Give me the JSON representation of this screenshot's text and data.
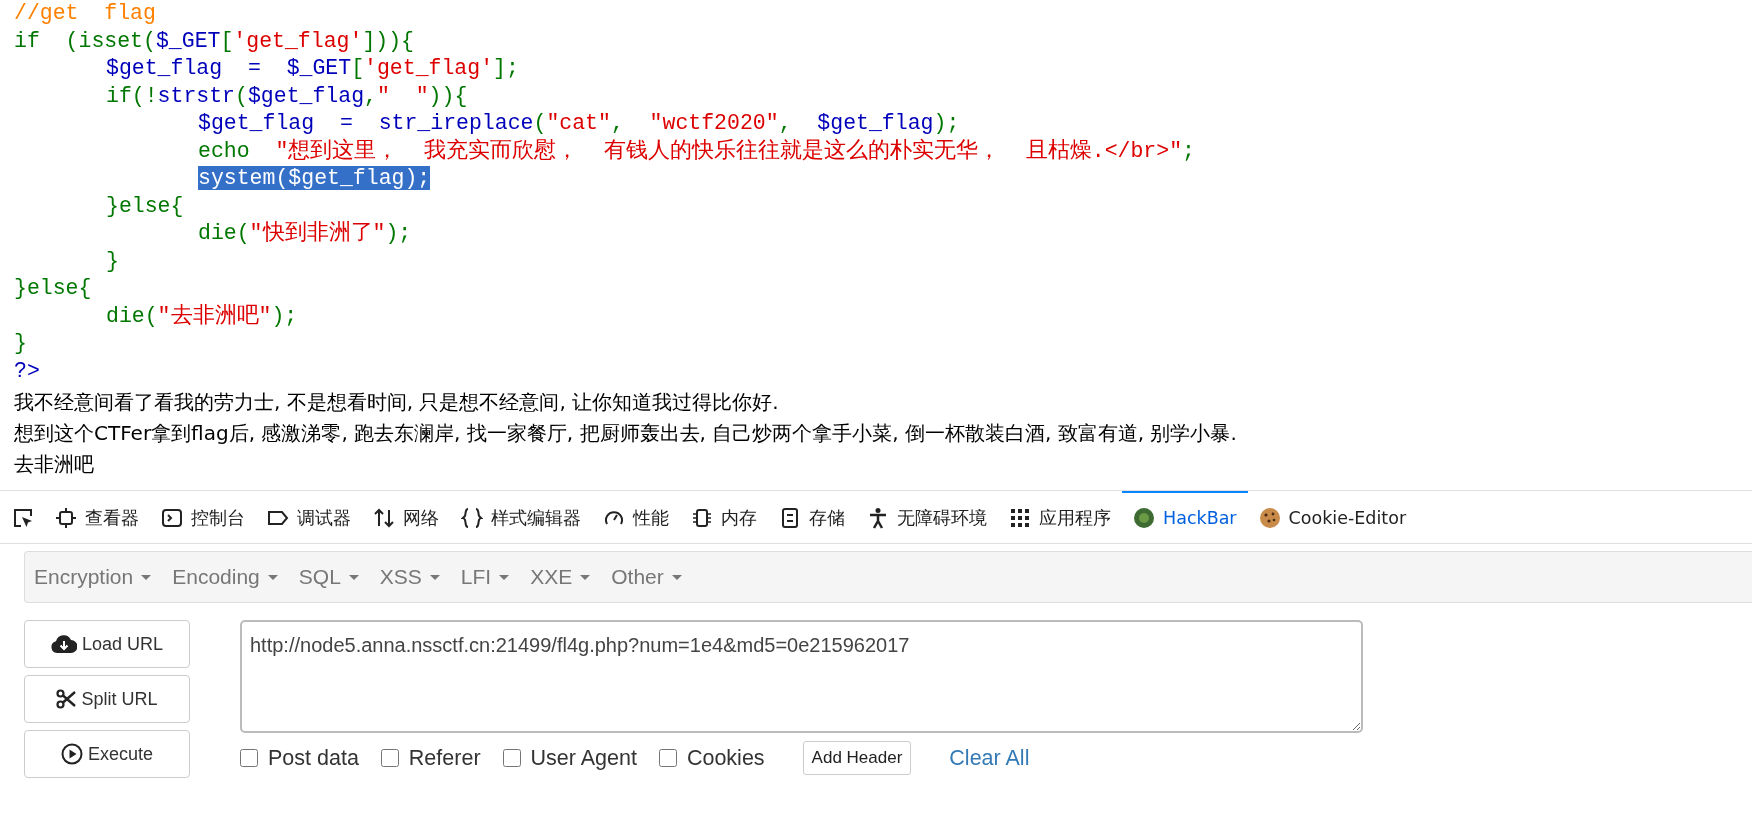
{
  "code": {
    "lines": [
      {
        "selected": false,
        "tokens": [
          {
            "t": "//get  flag",
            "kind": "comment"
          }
        ]
      },
      {
        "selected": false,
        "tokens": [
          {
            "t": "if  (isset(",
            "kind": "keyword"
          },
          {
            "t": "$_GET",
            "kind": "default"
          },
          {
            "t": "[",
            "kind": "keyword"
          },
          {
            "t": "'get_flag'",
            "kind": "string"
          },
          {
            "t": "])){",
            "kind": "keyword"
          }
        ],
        "children": [
          {
            "selected": false,
            "tokens": [
              {
                "t": "$get_flag  =  $_GET",
                "kind": "default"
              },
              {
                "t": "[",
                "kind": "keyword"
              },
              {
                "t": "'get_flag'",
                "kind": "string"
              },
              {
                "t": "];",
                "kind": "keyword"
              }
            ]
          },
          {
            "selected": false,
            "tokens": [
              {
                "t": "if(!",
                "kind": "keyword"
              },
              {
                "t": "strstr",
                "kind": "default"
              },
              {
                "t": "(",
                "kind": "keyword"
              },
              {
                "t": "$get_flag",
                "kind": "default"
              },
              {
                "t": ",",
                "kind": "keyword"
              },
              {
                "t": "\"  \"",
                "kind": "string"
              },
              {
                "t": ")){",
                "kind": "keyword"
              }
            ],
            "children": [
              {
                "selected": false,
                "tokens": [
                  {
                    "t": "$get_flag  =  str_ireplace",
                    "kind": "default"
                  },
                  {
                    "t": "(",
                    "kind": "keyword"
                  },
                  {
                    "t": "\"cat\"",
                    "kind": "string"
                  },
                  {
                    "t": ",  ",
                    "kind": "keyword"
                  },
                  {
                    "t": "\"wctf2020\"",
                    "kind": "string"
                  },
                  {
                    "t": ",  ",
                    "kind": "keyword"
                  },
                  {
                    "t": "$get_flag",
                    "kind": "default"
                  },
                  {
                    "t": ");",
                    "kind": "keyword"
                  }
                ]
              },
              {
                "selected": false,
                "tokens": [
                  {
                    "t": "echo  ",
                    "kind": "keyword"
                  },
                  {
                    "t": "\"想到这里，  我充实而欣慰，  有钱人的快乐往往就是这么的朴实无华，  且枯燥.</br>\"",
                    "kind": "string"
                  },
                  {
                    "t": ";",
                    "kind": "keyword"
                  }
                ]
              },
              {
                "selected": true,
                "tokens": [
                  {
                    "t": "system",
                    "kind": "default"
                  },
                  {
                    "t": "(",
                    "kind": "keyword"
                  },
                  {
                    "t": "$get_flag",
                    "kind": "default"
                  },
                  {
                    "t": ");",
                    "kind": "keyword"
                  }
                ]
              }
            ]
          },
          {
            "selected": false,
            "tokens": [
              {
                "t": "}else{",
                "kind": "keyword"
              }
            ],
            "children": [
              {
                "selected": false,
                "tokens": [
                  {
                    "t": "die(",
                    "kind": "keyword"
                  },
                  {
                    "t": "\"快到非洲了\"",
                    "kind": "string"
                  },
                  {
                    "t": ");",
                    "kind": "keyword"
                  }
                ]
              }
            ]
          },
          {
            "selected": false,
            "tokens": [
              {
                "t": "}",
                "kind": "keyword"
              }
            ]
          }
        ]
      },
      {
        "selected": false,
        "tokens": [
          {
            "t": "}else{",
            "kind": "keyword"
          }
        ],
        "children": [
          {
            "selected": false,
            "tokens": [
              {
                "t": "die(",
                "kind": "keyword"
              },
              {
                "t": "\"去非洲吧\"",
                "kind": "string"
              },
              {
                "t": ");",
                "kind": "keyword"
              }
            ]
          }
        ]
      },
      {
        "selected": false,
        "tokens": [
          {
            "t": "}",
            "kind": "keyword"
          }
        ]
      },
      {
        "selected": false,
        "tokens": [
          {
            "t": "?>",
            "kind": "default"
          }
        ]
      }
    ]
  },
  "output": [
    "我不经意间看了看我的劳力士, 不是想看时间, 只是想不经意间, 让你知道我过得比你好.",
    "想到这个CTFer拿到flag后, 感激涕零, 跑去东澜岸, 找一家餐厅, 把厨师轰出去, 自己炒两个拿手小菜, 倒一杯散装白酒, 致富有道, 别学小暴.",
    "去非洲吧"
  ],
  "devtools": {
    "tabs": [
      {
        "label": "查看器",
        "selected": false
      },
      {
        "label": "控制台",
        "selected": false
      },
      {
        "label": "调试器",
        "selected": false
      },
      {
        "label": "网络",
        "selected": false
      },
      {
        "label": "样式编辑器",
        "selected": false
      },
      {
        "label": "性能",
        "selected": false
      },
      {
        "label": "内存",
        "selected": false
      },
      {
        "label": "存储",
        "selected": false
      },
      {
        "label": "无障碍环境",
        "selected": false
      },
      {
        "label": "应用程序",
        "selected": false
      },
      {
        "label": "HackBar",
        "selected": true
      },
      {
        "label": "Cookie-Editor",
        "selected": false
      }
    ]
  },
  "hackbar": {
    "menus": [
      "Encryption",
      "Encoding",
      "SQL",
      "XSS",
      "LFI",
      "XXE",
      "Other"
    ],
    "buttons": [
      "Load URL",
      "Split URL",
      "Execute"
    ],
    "url": "http://node5.anna.nssctf.cn:21499/fl4g.php?num=1e4&md5=0e215962017",
    "options": [
      {
        "label": "Post data",
        "checked": false
      },
      {
        "label": "Referer",
        "checked": false
      },
      {
        "label": "User Agent",
        "checked": false
      },
      {
        "label": "Cookies",
        "checked": false
      }
    ],
    "add_header": "Add Header",
    "clear_all": "Clear All"
  }
}
